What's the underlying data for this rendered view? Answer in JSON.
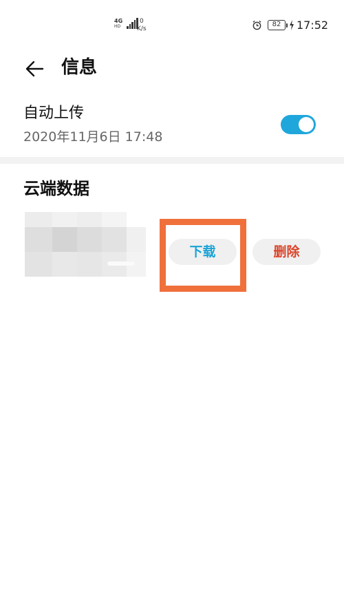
{
  "status_bar": {
    "network_type": "4G",
    "network_sub": "HD",
    "speed_value": "0",
    "speed_unit": "K/s",
    "battery": "82",
    "time": "17:52"
  },
  "header": {
    "back_icon": "arrow-left-icon",
    "title": "信息"
  },
  "auto_upload": {
    "label": "自动上传",
    "last_time": "2020年11月6日 17:48",
    "enabled": true
  },
  "cloud_data": {
    "section_title": "云端数据",
    "item": {
      "thumbnail": "blurred-image",
      "download_label": "下载",
      "delete_label": "删除"
    }
  },
  "colors": {
    "accent": "#1fa7dc",
    "download_text": "#1aa3d6",
    "delete_text": "#d9452c",
    "highlight_box": "#f0703c"
  }
}
